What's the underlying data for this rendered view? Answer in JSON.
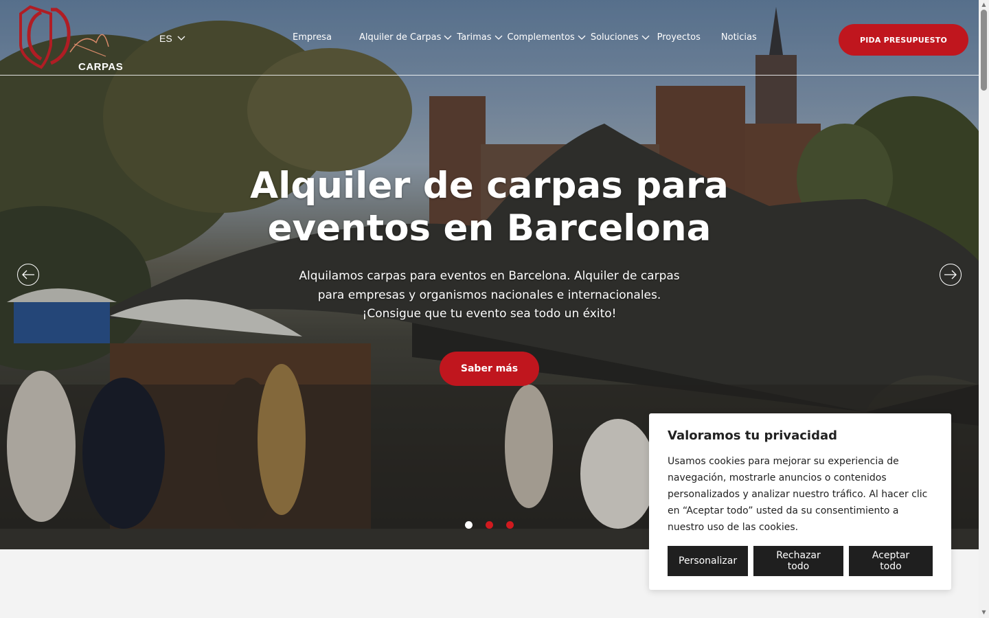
{
  "brand": {
    "logo_text": "CARPAS",
    "accent_color": "#c0161e"
  },
  "header": {
    "language": "ES",
    "nav": [
      {
        "label": "Empresa",
        "has_dropdown": false
      },
      {
        "label": "Alquiler de Carpas",
        "has_dropdown": true
      },
      {
        "label": "Tarimas",
        "has_dropdown": true
      },
      {
        "label": "Complementos",
        "has_dropdown": true
      },
      {
        "label": "Soluciones",
        "has_dropdown": true
      },
      {
        "label": "Proyectos",
        "has_dropdown": false
      },
      {
        "label": "Noticias",
        "has_dropdown": false
      }
    ],
    "cta_label": "PIDA PRESUPUESTO"
  },
  "hero": {
    "title_line1": "Alquiler de carpas para",
    "title_line2": "eventos en Barcelona",
    "sub_line1": "Alquilamos carpas para eventos en Barcelona. Alquiler de carpas",
    "sub_line2": "para empresas y organismos nacionales e internacionales.",
    "sub_line3": "¡Consigue que tu evento sea todo un éxito!",
    "button_label": "Saber más",
    "slides": {
      "count": 3,
      "active": 1
    }
  },
  "cookie": {
    "title": "Valoramos tu privacidad",
    "text": "Usamos cookies para mejorar su experiencia de navegación, mostrarle anuncios o contenidos personalizados y analizar nuestro tráfico. Al hacer clic en “Aceptar todo” usted da su consentimiento a nuestro uso de las cookies.",
    "customize_label": "Personalizar",
    "reject_label": "Rechazar todo",
    "accept_label": "Aceptar todo"
  }
}
